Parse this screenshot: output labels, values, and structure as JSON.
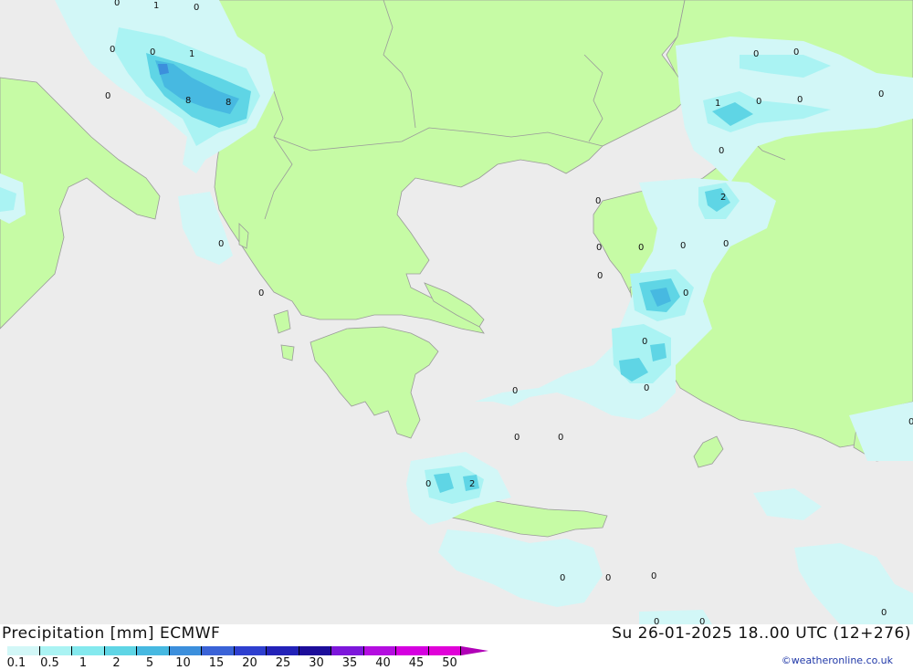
{
  "header": {
    "left_title": "Precipitation [mm] ECMWF",
    "right_title": "Su 26-01-2025 18..00 UTC (12+276)"
  },
  "legend": {
    "ticks": [
      "0.1",
      "0.5",
      "1",
      "2",
      "5",
      "10",
      "15",
      "20",
      "25",
      "30",
      "35",
      "40",
      "45",
      "50"
    ],
    "colors": [
      "#d2f7f7",
      "#aaf3f3",
      "#84e9ee",
      "#5fd5e5",
      "#47b9e1",
      "#3c8fdc",
      "#3a63d7",
      "#2e3fcf",
      "#2322b8",
      "#1c0d9a",
      "#7d17db",
      "#b40ee0",
      "#d500e0",
      "#e002d8",
      "#b100b7"
    ]
  },
  "colors": {
    "sea": "#ececec",
    "land": "#c6fba5",
    "precip_light": "#d2f7f7",
    "precip_mid": "#aaf3f3",
    "precip_heavy": "#5fd5e5",
    "precip_core": "#3c8fdc"
  },
  "map": {
    "value_labels": [
      "0",
      "1",
      "0",
      "0",
      "0",
      "1",
      "0",
      "8",
      "8",
      "0",
      "0",
      "0",
      "0",
      "0",
      "1",
      "0",
      "0",
      "0",
      "0",
      "2",
      "0",
      "0",
      "0",
      "0",
      "0",
      "0",
      "0",
      "0",
      "0",
      "0",
      "0",
      "0",
      "2",
      "0",
      "0",
      "0",
      "0",
      "0",
      "0",
      "0"
    ]
  },
  "credit": "©weatheronline.co.uk"
}
